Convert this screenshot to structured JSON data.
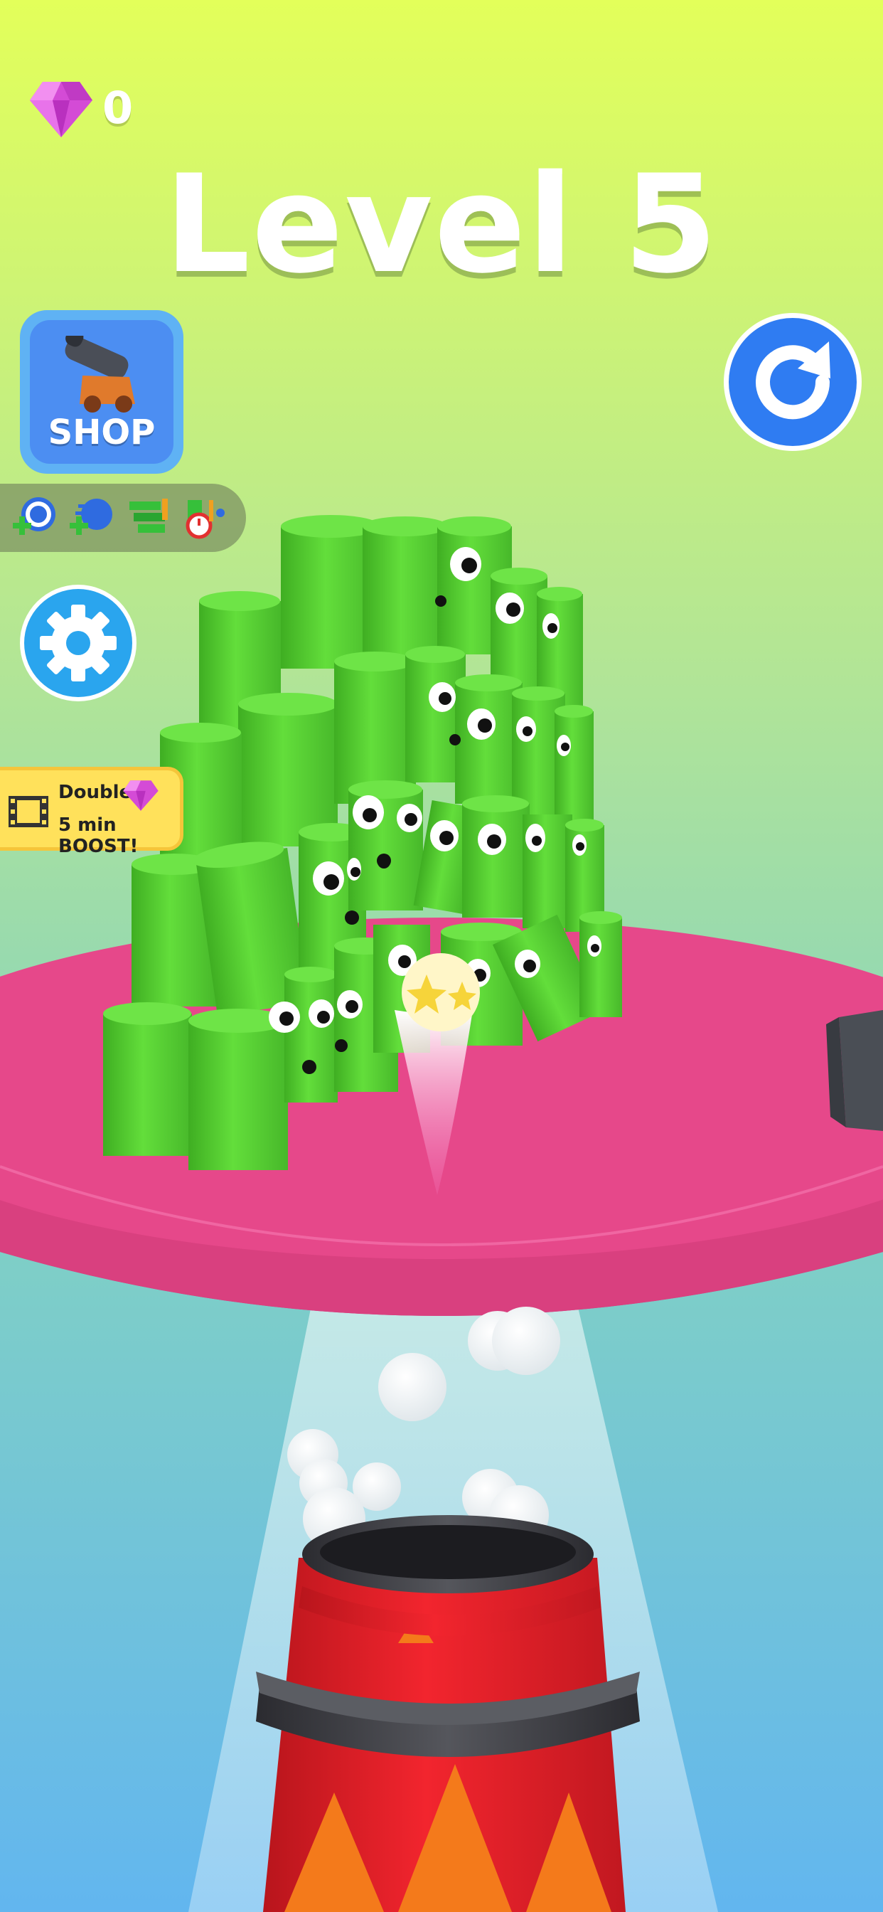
{
  "hud": {
    "gem_count": "0",
    "level_title": "Level 5",
    "shop_label": "SHOP"
  },
  "boost": {
    "line1": "Double",
    "line2": "5 min BOOST!"
  },
  "icons": {
    "gem": "diamond-icon",
    "restart": "restart-arrow-icon",
    "settings": "gear-icon",
    "shop": "cannon-icon",
    "boost": "film-icon"
  },
  "powerups": [
    "add-ball-power-icon",
    "add-speed-power-icon",
    "stack-power-icon",
    "timer-power-icon"
  ],
  "colors": {
    "sky_top": "#e3ff5a",
    "sky_bottom": "#62b6ef",
    "platform": "#e6488a",
    "tube_green": "#59d83a",
    "cannon_red": "#e8222b",
    "shop_blue": "#4c8ef2",
    "restart_blue": "#2f7cf2",
    "boost_yellow": "#ffe15b"
  }
}
